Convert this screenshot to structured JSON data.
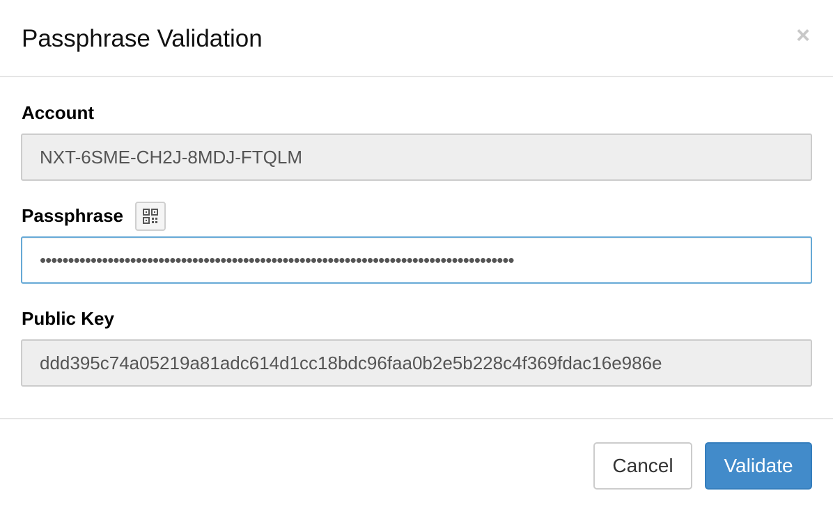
{
  "header": {
    "title": "Passphrase Validation",
    "close_label": "×"
  },
  "form": {
    "account": {
      "label": "Account",
      "value": "NXT-6SME-CH2J-8MDJ-FTQLM"
    },
    "passphrase": {
      "label": "Passphrase",
      "masked_value": "••••••••••••••••••••••••••••••••••••••••••••••••••••••••••••••••••••••••••••••••••••",
      "qr_icon": "qr-code-icon"
    },
    "public_key": {
      "label": "Public Key",
      "value": "ddd395c74a05219a81adc614d1cc18bdc96faa0b2e5b228c4f369fdac16e986e"
    }
  },
  "footer": {
    "cancel_label": "Cancel",
    "validate_label": "Validate"
  },
  "colors": {
    "primary": "#428bca",
    "focus_border": "#66a9d6",
    "readonly_bg": "#eeeeee"
  }
}
